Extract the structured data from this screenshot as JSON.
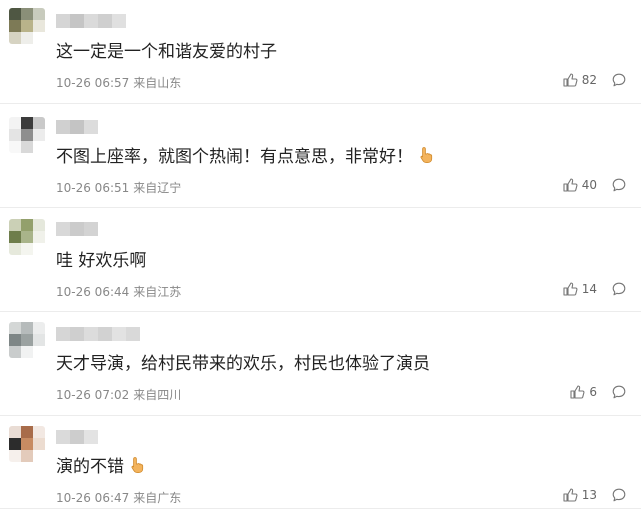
{
  "comments": [
    {
      "text": "这一定是一个和谐友爱的村子",
      "time": "10-26 06:57",
      "location": "来自山东",
      "likes": "82",
      "emoji": false,
      "avatar_colors": [
        "#4f5743",
        "#8a8f78",
        "#c8cbbd",
        "#7d7a56",
        "#b9b38a",
        "#e9e7dc",
        "#d6d3c2",
        "#eeeeea",
        "#ffffff"
      ],
      "name_colors": [
        "#d5d5d5",
        "#c5c5c5",
        "#dadada",
        "#cfcfcf",
        "#e0e0e0"
      ]
    },
    {
      "text": "不图上座率，就图个热闹！有点意思，非常好！",
      "time": "10-26 06:51",
      "location": "来自辽宁",
      "likes": "40",
      "emoji": true,
      "avatar_colors": [
        "#f3f3f3",
        "#3b3b3b",
        "#c9c9c9",
        "#e4e4e4",
        "#8e8e8e",
        "#ececec",
        "#f8f8f8",
        "#d9d9d9",
        "#ffffff"
      ],
      "name_colors": [
        "#d0d0d0",
        "#c4c4c4",
        "#dcdcdc"
      ]
    },
    {
      "text": "哇 好欢乐啊",
      "time": "10-26 06:44",
      "location": "来自江苏",
      "likes": "14",
      "emoji": false,
      "avatar_colors": [
        "#cbd0b6",
        "#93a06c",
        "#e5e8dc",
        "#6e7d4b",
        "#a9b48a",
        "#f0f1ea",
        "#e6e9dc",
        "#f4f5ef",
        "#ffffff"
      ],
      "name_colors": [
        "#d8d8d8",
        "#cbcbcb",
        "#d3d3d3"
      ]
    },
    {
      "text": "天才导演，给村民带来的欢乐，村民也体验了演员",
      "time": "10-26 07:02",
      "location": "来自四川",
      "likes": "6",
      "emoji": false,
      "avatar_colors": [
        "#d4d7d6",
        "#b6bbbb",
        "#eceded",
        "#7e8686",
        "#9ba2a1",
        "#e3e5e5",
        "#c9cccc",
        "#f1f2f2",
        "#ffffff"
      ],
      "name_colors": [
        "#d6d6d6",
        "#cfcfcf",
        "#dcdcdc",
        "#d2d2d2",
        "#e2e2e2",
        "#d9d9d9"
      ]
    },
    {
      "text": "演的不错",
      "time": "10-26 06:47",
      "location": "来自广东",
      "likes": "13",
      "emoji": true,
      "avatar_colors": [
        "#e9dcd4",
        "#a86c4a",
        "#f2e8e2",
        "#2c2c2c",
        "#c78b62",
        "#ecdcd0",
        "#f6f0ec",
        "#e3cbbb",
        "#ffffff"
      ],
      "name_colors": [
        "#dadada",
        "#cdcdcd",
        "#e3e3e3"
      ]
    }
  ]
}
